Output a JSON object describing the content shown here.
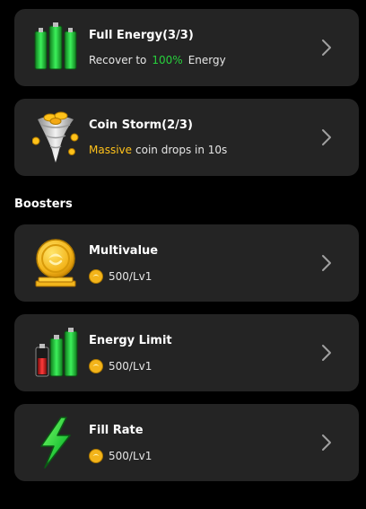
{
  "boosts": [
    {
      "title": "Full Energy(3/3)",
      "sub_prefix": "Recover to",
      "sub_highlight": "100%",
      "sub_suffix": "Energy",
      "icon": "battery-icon"
    },
    {
      "title": "Coin Storm(2/3)",
      "sub_highlight": "Massive",
      "sub_suffix": "coin drops in 10s",
      "icon": "coin-tornado-icon"
    }
  ],
  "section": {
    "title": "Boosters"
  },
  "boosters": [
    {
      "title": "Multivalue",
      "cost": "500/Lv1",
      "icon": "gold-coin-icon"
    },
    {
      "title": "Energy Limit",
      "cost": "500/Lv1",
      "icon": "energy-batteries-icon"
    },
    {
      "title": "Fill Rate",
      "cost": "500/Lv1",
      "icon": "lightning-icon"
    }
  ],
  "colors": {
    "background": "#000000",
    "card": "#242424",
    "green_highlight": "#27d13c",
    "yellow_highlight": "#ffc21a"
  }
}
